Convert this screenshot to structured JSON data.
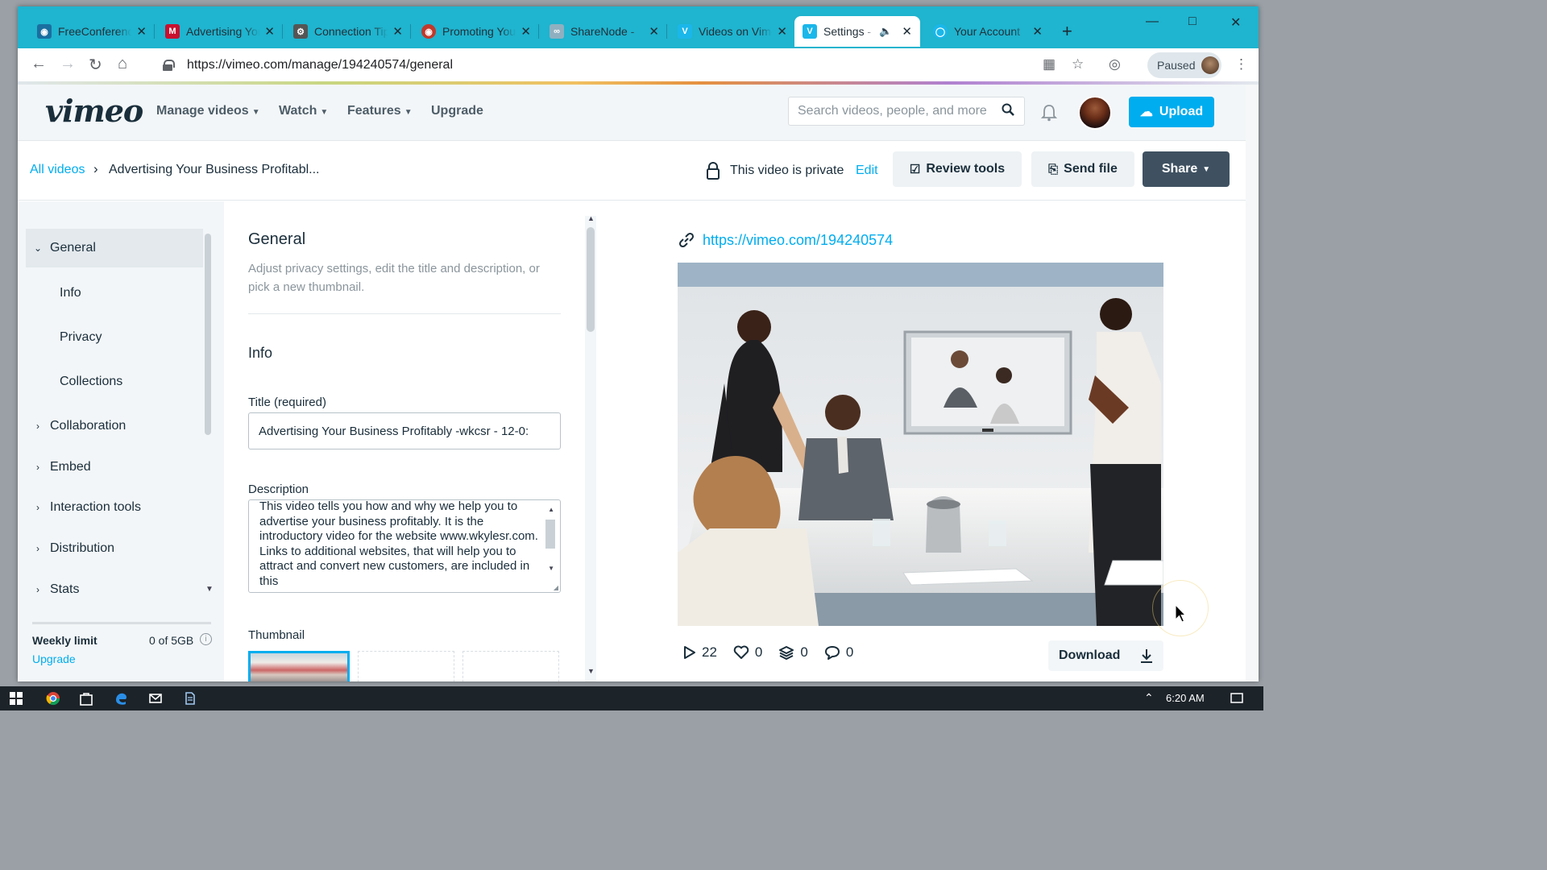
{
  "browser": {
    "tabs": [
      {
        "title": "FreeConferenceCall",
        "icon": "camera-icon",
        "color": "#1a6fa0"
      },
      {
        "title": "Advertising Your Business",
        "icon": "m-logo-icon",
        "color": "#c8102e"
      },
      {
        "title": "Connection Tips",
        "icon": "network-icon",
        "color": "#555555"
      },
      {
        "title": "Promoting Your",
        "icon": "globe-icon",
        "color": "#c0392b"
      },
      {
        "title": "ShareNode - ",
        "icon": "sharenode-icon",
        "color": "#a0b0b8"
      },
      {
        "title": "Videos on Vimeo",
        "icon": "vimeo-icon",
        "color": "#1ab7ea"
      },
      {
        "title": "Settings - ",
        "icon": "vimeo-icon",
        "color": "#1ab7ea",
        "active": true
      },
      {
        "title": "Your Account",
        "icon": "account-icon",
        "color": "#1ab7ea"
      }
    ],
    "url": "https://vimeo.com/manage/194240574/general",
    "profile_status": "Paused"
  },
  "header": {
    "logo": "vimeo",
    "nav": [
      "Manage videos",
      "Watch",
      "Features",
      "Upgrade"
    ],
    "search_placeholder": "Search videos, people, and more",
    "upload_label": "Upload"
  },
  "crumbbar": {
    "root": "All videos",
    "current": "Advertising Your Business Profitabl...",
    "privacy_text": "This video is private",
    "edit_label": "Edit",
    "review_label": "Review tools",
    "send_label": "Send file",
    "share_label": "Share"
  },
  "sidebar": {
    "items": [
      {
        "label": "General",
        "expanded": true
      },
      {
        "label": "Info",
        "sub": true
      },
      {
        "label": "Privacy",
        "sub": true
      },
      {
        "label": "Collections",
        "sub": true
      },
      {
        "label": "Collaboration"
      },
      {
        "label": "Embed"
      },
      {
        "label": "Interaction tools"
      },
      {
        "label": "Distribution"
      },
      {
        "label": "Stats"
      }
    ],
    "weekly_limit_label": "Weekly limit",
    "weekly_limit_value": "0 of 5GB",
    "upgrade_label": "Upgrade"
  },
  "form": {
    "heading": "General",
    "description": "Adjust privacy settings, edit the title and description, or pick a new thumbnail.",
    "info_heading": "Info",
    "title_label": "Title (required)",
    "title_value": "Advertising Your Business Profitably -wkcsr - 12-0:",
    "description_label": "Description",
    "description_value": "This video tells you how and why we help you to advertise your business profitably. It is the introductory video for the website www.wkylesr.com.  Links to additional websites, that will help you to attract and convert new customers, are included in this",
    "thumbnail_label": "Thumbnail"
  },
  "preview": {
    "link": "https://vimeo.com/194240574",
    "plays": "22",
    "likes": "0",
    "collections": "0",
    "comments": "0",
    "download_label": "Download"
  },
  "taskbar": {
    "time": "6:20 AM"
  },
  "colors": {
    "accent": "#00adef",
    "tabstrip": "#1fb4cf",
    "share": "#3f5161"
  }
}
